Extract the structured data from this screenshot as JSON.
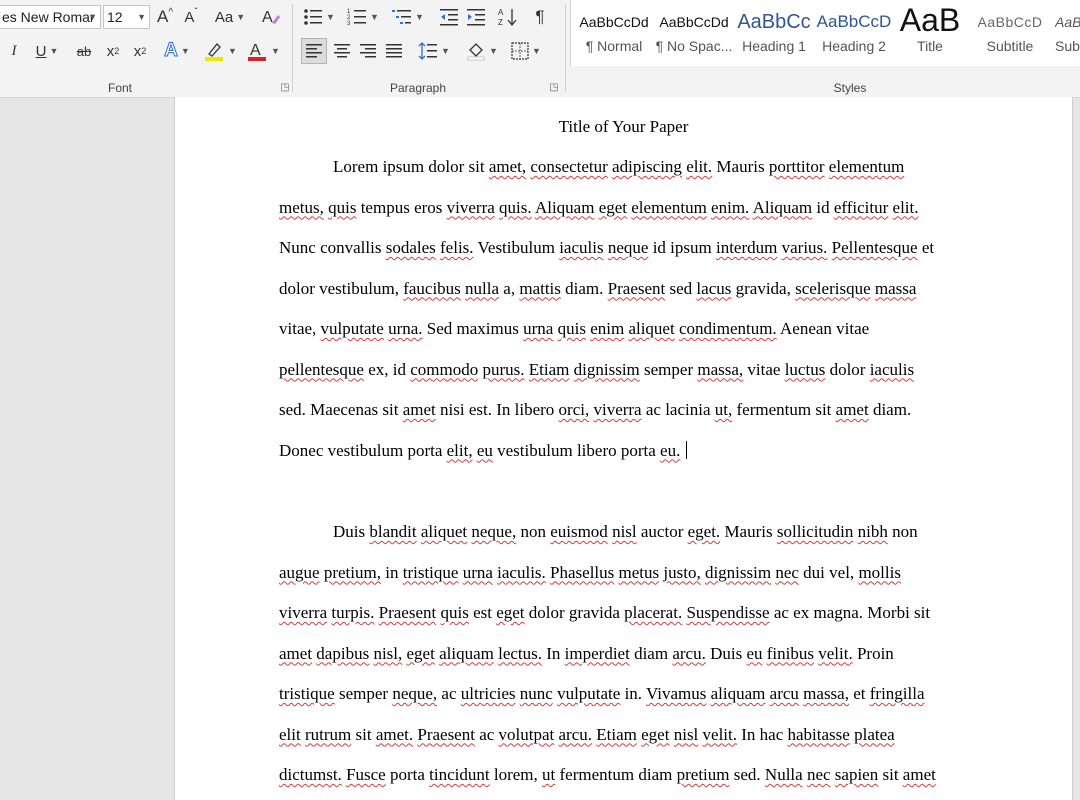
{
  "ribbon": {
    "font": {
      "group_label": "Font",
      "font_name": "es New Romar",
      "font_size": "12",
      "change_case_label": "Aa",
      "grow_font_label": "A",
      "shrink_font_label": "A",
      "italic_label": "I",
      "underline_label": "U",
      "strikethrough_label": "ab",
      "subscript_label": "x",
      "subscript_sub": "2",
      "superscript_label": "x",
      "superscript_sup": "2",
      "text_effects_label": "A",
      "font_color_label": "A",
      "highlight_color": "#f2e600",
      "font_color": "#e02020"
    },
    "paragraph": {
      "group_label": "Paragraph",
      "show_marks_label": "¶",
      "active_alignment": "align-left"
    },
    "styles": {
      "group_label": "Styles",
      "items": [
        {
          "sample": "AaBbCcDd",
          "name": "¶ Normal"
        },
        {
          "sample": "AaBbCcDd",
          "name": "¶ No Spac..."
        },
        {
          "sample": "AaBbCc",
          "name": "Heading 1"
        },
        {
          "sample": "AaBbCcD",
          "name": "Heading 2"
        },
        {
          "sample": "AaB",
          "name": "Title"
        },
        {
          "sample": "AaBbCcD",
          "name": "Subtitle"
        },
        {
          "sample": "AaBl",
          "name": "Subt"
        }
      ],
      "accent_color": "#2f5597"
    }
  },
  "document": {
    "title": "Title of Your Paper",
    "paragraphs": [
      {
        "lines": [
          "Lorem ipsum dolor sit amet, consectetur adipiscing elit. Mauris porttitor elementum",
          "metus, quis tempus eros viverra quis. Aliquam eget elementum enim. Aliquam id efficitur elit.",
          "Nunc convallis sodales felis. Vestibulum iaculis neque id ipsum interdum varius. Pellentesque et",
          "dolor vestibulum, faucibus nulla a, mattis diam. Praesent sed lacus gravida, scelerisque massa",
          "vitae, vulputate urna. Sed maximus urna quis enim aliquet condimentum. Aenean vitae",
          "pellentesque ex, id commodo purus. Etiam dignissim semper massa, vitae luctus dolor iaculis",
          "sed. Maecenas sit amet nisi est. In libero orci, viverra ac lacinia ut, fermentum sit amet diam.",
          "Donec vestibulum porta elit, eu vestibulum libero porta eu."
        ]
      },
      {
        "lines": [
          "Duis blandit aliquet neque, non euismod nisl auctor eget. Mauris sollicitudin nibh non",
          "augue pretium, in tristique urna iaculis. Phasellus metus justo, dignissim nec dui vel, mollis",
          "viverra turpis. Praesent quis est eget dolor gravida placerat. Suspendisse ac ex magna. Morbi sit",
          "amet dapibus nisl, eget aliquam lectus. In imperdiet diam arcu. Duis eu finibus velit. Proin",
          "tristique semper neque, ac ultricies nunc vulputate in. Vivamus aliquam arcu massa, et fringilla",
          "elit rutrum sit amet. Praesent ac volutpat arcu. Etiam eget nisl velit. In hac habitasse platea",
          "dictumst. Fusce porta tincidunt lorem, ut fermentum diam pretium sed. Nulla nec sapien sit amet"
        ]
      }
    ],
    "spellcheck_underline_color": "#d83b3b",
    "spell_flagged_words": [
      "amet",
      "consectetur",
      "adipiscing",
      "elit",
      "porttitor",
      "elementum",
      "metus",
      "quis",
      "viverra",
      "Aliquam",
      "eget",
      "enim",
      "efficitur",
      "sodales",
      "felis",
      "iaculis",
      "neque",
      "interdum",
      "varius",
      "Pellentesque",
      "faucibus",
      "nulla",
      "mattis",
      "Praesent",
      "lacus",
      "scelerisque",
      "massa",
      "vulputate",
      "urna",
      "aliquet",
      "condimentum",
      "pellentesque",
      "commodo",
      "purus",
      "Etiam",
      "dignissim",
      "massa",
      "luctus",
      "orci",
      "ut",
      "eu",
      "blandit",
      "euismod",
      "nisl",
      "sollicitudin",
      "nibh",
      "augue",
      "pretium",
      "tristique",
      "Phasellus",
      "justo",
      "nec",
      "mollis",
      "turpis",
      "placerat",
      "Suspendisse",
      "dapibus",
      "aliquam",
      "lectus",
      "imperdiet",
      "arcu",
      "finibus",
      "velit",
      "ultricies",
      "nunc",
      "Vivamus",
      "fringilla",
      "rutrum",
      "volutpat",
      "habitasse",
      "platea",
      "dictumst",
      "Fusce",
      "tincidunt",
      "Nulla",
      "sapien"
    ]
  }
}
